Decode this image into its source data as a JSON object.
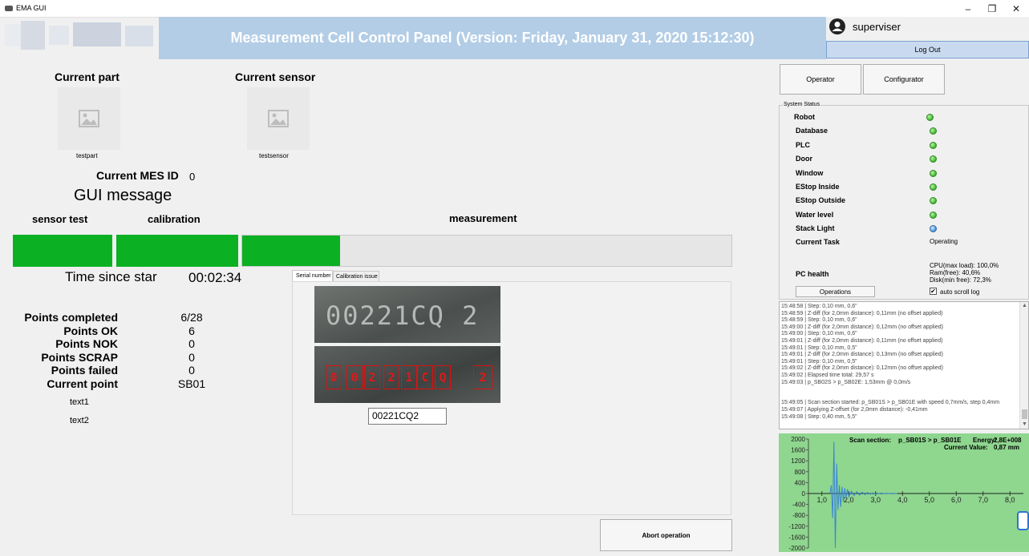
{
  "window": {
    "title": "EMA GUI",
    "minimize": "–",
    "restore": "❐",
    "close": "✕"
  },
  "header": {
    "title": "Measurement Cell Control Panel (Version: Friday, January 31, 2020 15:12:30)"
  },
  "user": {
    "name": "superviser",
    "logout_label": "Log Out"
  },
  "nav": {
    "operator_label": "Operator",
    "configurator_label": "Configurator"
  },
  "part": {
    "heading": "Current part",
    "name": "testpart"
  },
  "sensor": {
    "heading": "Current sensor",
    "name": "testsensor"
  },
  "mes": {
    "label": "Current MES ID",
    "value": "0"
  },
  "gui_message": "GUI message",
  "progress": {
    "steps": [
      {
        "label": "sensor test",
        "fill": 1.0
      },
      {
        "label": "calibration",
        "fill": 1.0
      },
      {
        "label": "measurement",
        "fill": 0.2
      }
    ],
    "color": "#0bb023"
  },
  "timer": {
    "label": "Time since star",
    "value": "00:02:34"
  },
  "stats": [
    {
      "label": "Points completed",
      "value": "6/28"
    },
    {
      "label": "Points OK",
      "value": "6"
    },
    {
      "label": "Points NOK",
      "value": "0"
    },
    {
      "label": "Points SCRAP",
      "value": "0"
    },
    {
      "label": "Points failed",
      "value": "0"
    },
    {
      "label": "Current point",
      "value": "SB01"
    }
  ],
  "text1": "text1",
  "text2": "text2",
  "tabs": {
    "serial": "Serial number",
    "calib": "Calibration issue"
  },
  "serial": {
    "ocr_text": "00221CQ 2",
    "value": "00221CQ2"
  },
  "abort_label": "Abort operation",
  "system_status": {
    "title": "System Status",
    "items": [
      {
        "name": "Robot",
        "state": "green"
      },
      {
        "name": "Database",
        "state": "green"
      },
      {
        "name": "PLC",
        "state": "green"
      },
      {
        "name": "Door",
        "state": "green"
      },
      {
        "name": "Window",
        "state": "green"
      },
      {
        "name": "EStop Inside",
        "state": "green"
      },
      {
        "name": "EStop Outside",
        "state": "green"
      },
      {
        "name": "Water level",
        "state": "green"
      },
      {
        "name": "Stack Light",
        "state": "blue"
      }
    ],
    "current_task_label": "Current Task",
    "current_task_value": "Operating",
    "pc_health_label": "PC health",
    "cpu": "CPU(max load): 100,0%",
    "ram": "Ram(free): 40,6%",
    "disk": "Disk(min free): 72,3%",
    "operations_label": "Operations",
    "autoscroll_label": "auto scroll log",
    "autoscroll_checked": true
  },
  "log": [
    "15:48:58 | Step: 0,10 mm, 0,6\"",
    "15:48:59 | Z-diff (for 2,0mm distance): 0,11mm (no offset applied)",
    "15:48:59 | Step: 0,10 mm, 0,6\"",
    "15:49:00 | Z-diff (for 2,0mm distance): 0,12mm (no offset applied)",
    "15:49:00 | Step: 0,10 mm, 0,6\"",
    "15:49:01 | Z-diff (for 2,0mm distance): 0,11mm (no offset applied)",
    "15:49:01 | Step: 0,10 mm, 0,5\"",
    "15:49:01 | Z-diff (for 2,0mm distance): 0,13mm (no offset applied)",
    "15:49:01 | Step: 0,10 mm, 0,5\"",
    "15:49:02 | Z-diff (for 2,0mm distance): 0,12mm (no offset applied)",
    "15:49:02 | Elapsed time total: 29,57 s",
    "15:49:03 | p_SB02S > p_SB02E: 1,53mm @ 0,0m/s",
    "",
    "",
    "15:49:05 | Scan section started: p_SB01S > p_SB01E with speed 0,7mm/s, step 0,4mm",
    "15:49:07 | Applying Z-offset (for 2,0mm distance): -0,41mm",
    "15:49:08 | Step: 0,40 mm, 5,5\""
  ],
  "chart_data": {
    "type": "line",
    "scan_section_label": "Scan section:",
    "scan_section_value": "p_SB01S > p_SB01E",
    "energy_label": "Energy:",
    "energy_value": "2,8E+008",
    "current_value_label": "Current Value:",
    "current_value": "0,87 mm",
    "y_ticks": [
      "2000",
      "1600",
      "1200",
      "800",
      "400",
      "0",
      "-400",
      "-800",
      "-1200",
      "-1600",
      "-2000"
    ],
    "x_ticks": [
      "1,0",
      "2,0",
      "3,0",
      "4,0",
      "5,0",
      "6,0",
      "7,0",
      "8,0"
    ],
    "ylim": [
      -2000,
      2000
    ],
    "xlim": [
      0.5,
      8.5
    ],
    "series": [
      {
        "x": [
          1.3,
          1.35,
          1.4,
          1.45,
          1.5,
          1.55,
          1.6,
          1.65,
          1.7,
          1.75,
          1.8,
          1.85,
          1.9,
          1.95,
          2.0,
          2.1,
          2.2,
          2.3,
          2.4,
          2.5,
          2.6,
          2.7,
          2.8,
          2.9,
          3.0,
          3.2,
          3.4,
          3.6,
          3.8
        ],
        "y": [
          0,
          300,
          -900,
          1900,
          -2000,
          1100,
          -600,
          300,
          -500,
          250,
          -300,
          200,
          -150,
          160,
          -120,
          90,
          -80,
          70,
          -60,
          50,
          -40,
          35,
          -30,
          25,
          -20,
          15,
          -10,
          8,
          0
        ]
      }
    ]
  }
}
